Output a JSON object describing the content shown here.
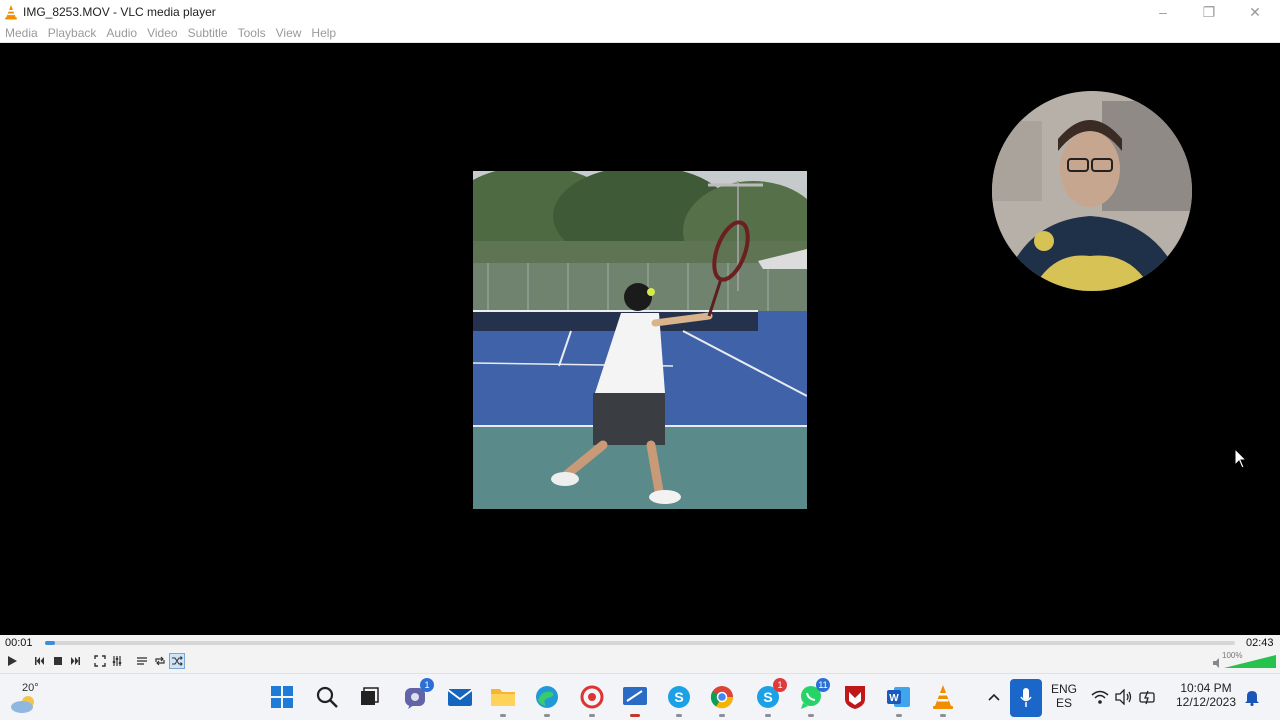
{
  "window": {
    "title": "IMG_8253.MOV - VLC media player",
    "controls": {
      "minimize": "–",
      "maximize": "❐",
      "close": "✕"
    }
  },
  "menu": [
    "Media",
    "Playback",
    "Audio",
    "Video",
    "Subtitle",
    "Tools",
    "View",
    "Help"
  ],
  "player": {
    "elapsed": "00:01",
    "total": "02:43",
    "progress": 0.006,
    "volume_label": "100%",
    "volume": 1.0,
    "shuffle_active": true,
    "buttons": [
      "play-icon",
      "previous-icon",
      "stop-icon",
      "next-icon",
      "fullscreen-icon",
      "extended-settings-icon",
      "playlist-icon",
      "loop-icon",
      "shuffle-icon"
    ]
  },
  "taskbar": {
    "weather": {
      "temp": "20°",
      "icon": "cloud-sun-icon"
    },
    "apps": [
      {
        "name": "windows-start",
        "icon": "windows-logo-icon"
      },
      {
        "name": "search",
        "icon": "search-icon"
      },
      {
        "name": "task-view",
        "icon": "task-view-icon"
      },
      {
        "name": "teams",
        "icon": "teams-icon",
        "badge": "1"
      },
      {
        "name": "mail",
        "icon": "mail-icon"
      },
      {
        "name": "file-explorer",
        "icon": "folder-icon"
      },
      {
        "name": "edge",
        "icon": "edge-icon"
      },
      {
        "name": "screen-recorder",
        "icon": "recorder-icon"
      },
      {
        "name": "snipping-tool",
        "icon": "snipping-icon"
      },
      {
        "name": "skype",
        "icon": "skype-icon"
      },
      {
        "name": "chrome",
        "icon": "chrome-icon"
      },
      {
        "name": "skype-2",
        "icon": "skype-icon",
        "badge": "1"
      },
      {
        "name": "whatsapp",
        "icon": "whatsapp-icon",
        "badge": "11"
      },
      {
        "name": "mcafee",
        "icon": "mcafee-icon"
      },
      {
        "name": "word",
        "icon": "word-icon"
      },
      {
        "name": "vlc",
        "icon": "vlc-icon"
      }
    ],
    "tray": {
      "language_top": "ENG",
      "language_bottom": "ES",
      "time": "10:04 PM",
      "date": "12/12/2023"
    }
  },
  "colors": {
    "accent": "#1a66c9",
    "seek": "#3b8fd9",
    "badge_red": "#e03a3a",
    "badge_blue": "#2c6fd6",
    "vlc_orange": "#f28c00"
  }
}
